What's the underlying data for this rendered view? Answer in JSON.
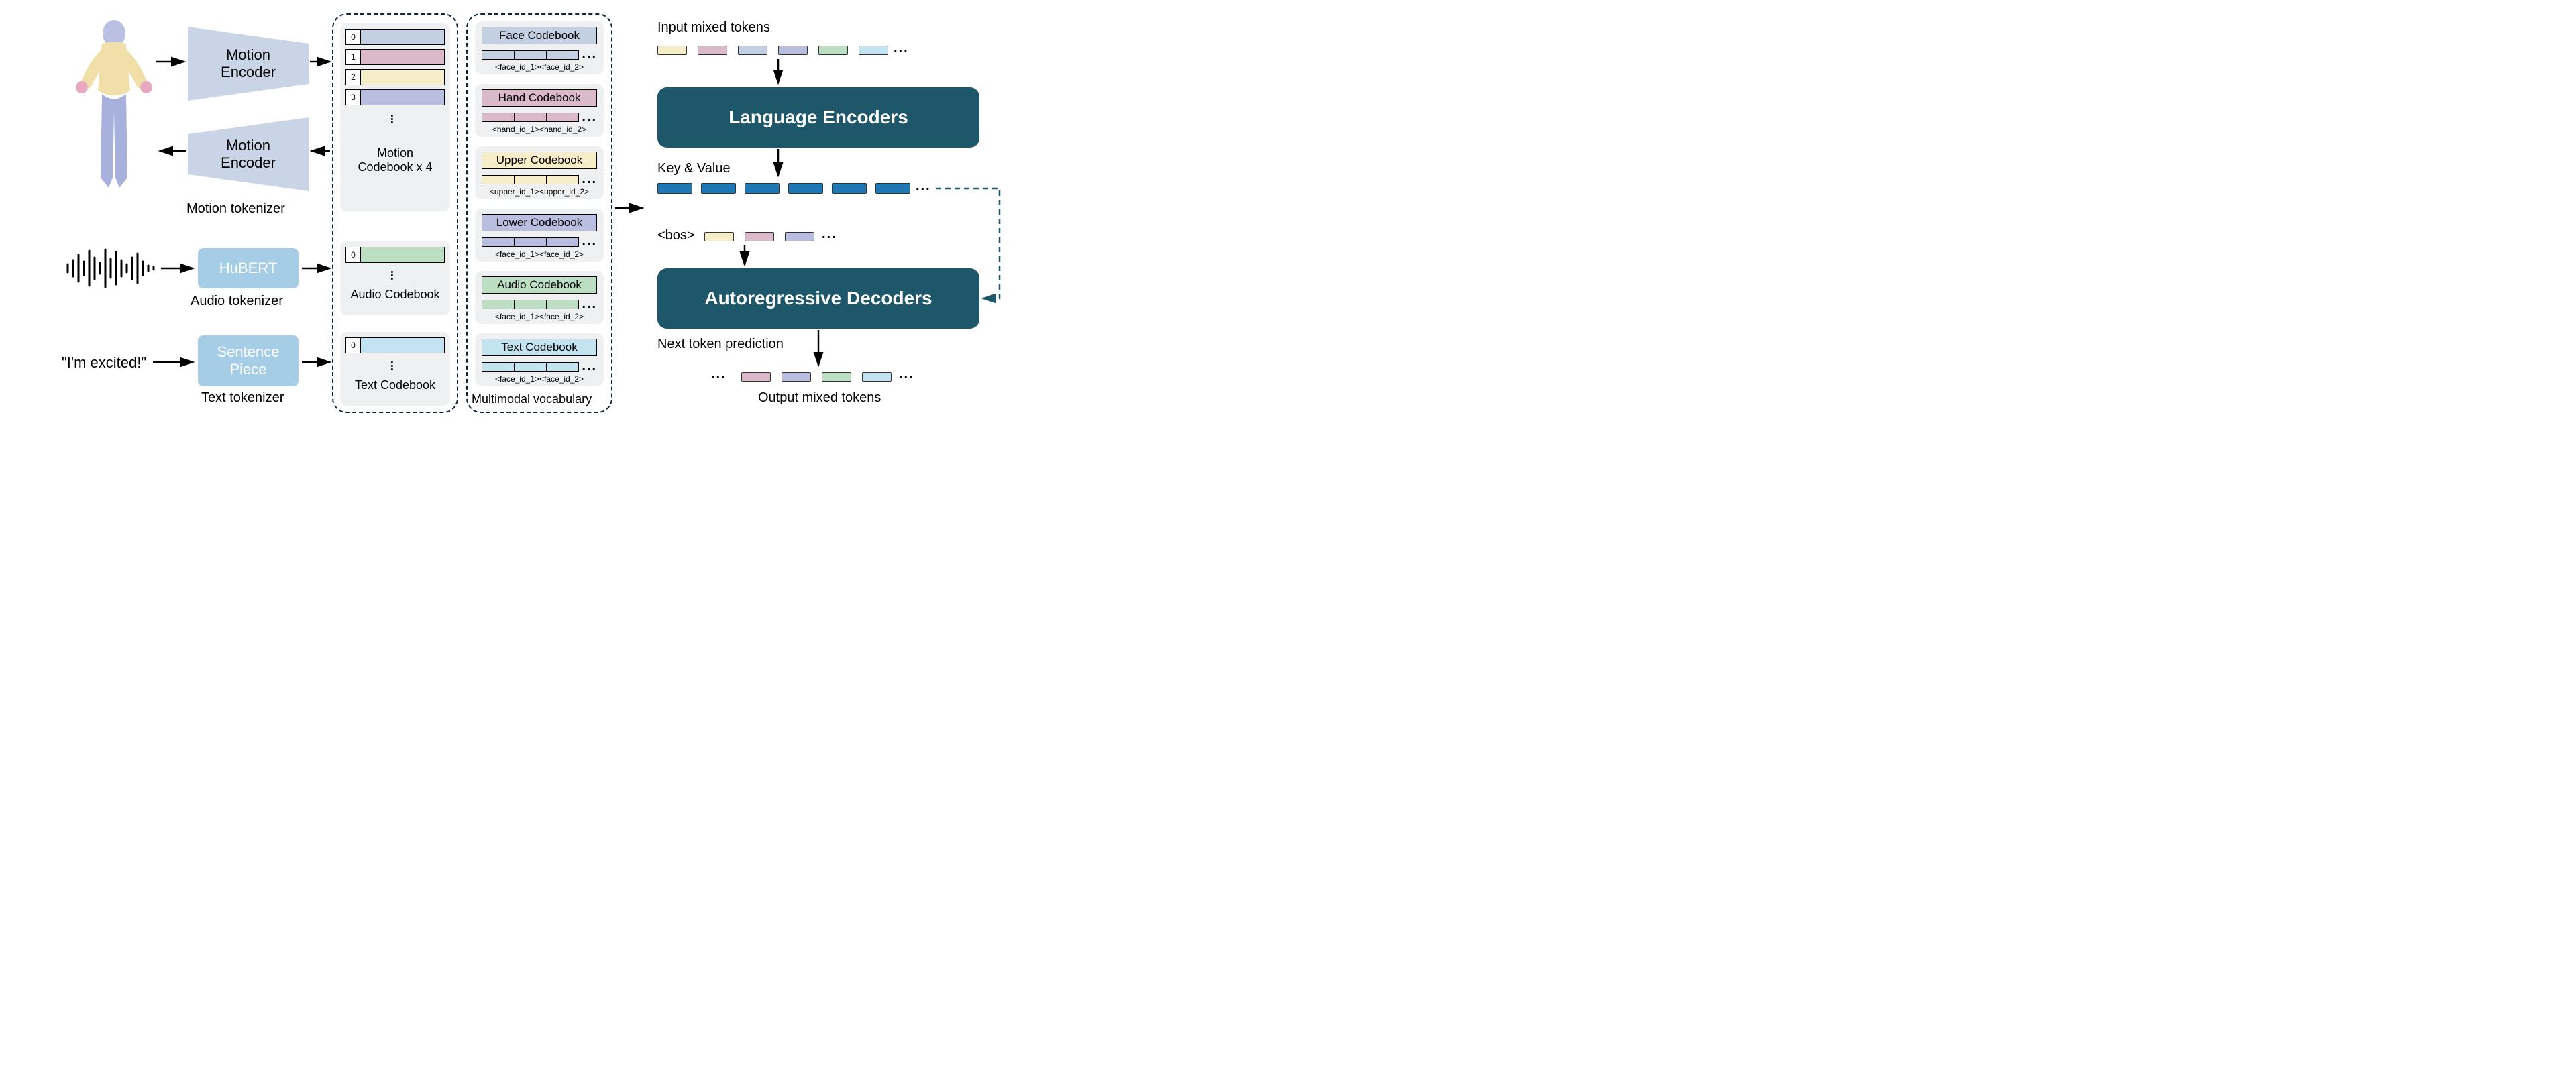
{
  "tokenizers": {
    "motion_encoder": "Motion\nEncoder",
    "motion_decoder": "Motion\nEncoder",
    "motion_label": "Motion tokenizer",
    "hubert": "HuBERT",
    "audio_label": "Audio tokenizer",
    "sentencepiece": "Sentence\nPiece",
    "text_label": "Text tokenizer",
    "text_input": "\"I'm excited!\""
  },
  "codebooks": {
    "motion_title": "Motion\nCodebook x 4",
    "audio_title": "Audio Codebook",
    "text_title": "Text Codebook",
    "idx": [
      "0",
      "1",
      "2",
      "3",
      "0",
      "0"
    ]
  },
  "vocab": {
    "title": "Multimodal vocabulary",
    "face": {
      "title": "Face Codebook",
      "ids": "<face_id_1><face_id_2>",
      "more": "..."
    },
    "hand": {
      "title": "Hand Codebook",
      "ids": "<hand_id_1><hand_id_2>",
      "more": "..."
    },
    "upper": {
      "title": "Upper Codebook",
      "ids": "<upper_id_1><upper_id_2>",
      "more": "..."
    },
    "lower": {
      "title": "Lower Codebook",
      "ids": "<face_id_1><face_id_2>",
      "more": "..."
    },
    "audio": {
      "title": "Audio Codebook",
      "ids": "<face_id_1><face_id_2>",
      "more": "..."
    },
    "text": {
      "title": "Text Codebook",
      "ids": "<face_id_1><face_id_2>",
      "more": "..."
    }
  },
  "model": {
    "input_label": "Input mixed tokens",
    "encoders": "Language Encoders",
    "kv_label": "Key & Value",
    "bos": "<bos>",
    "decoders": "Autoregressive Decoders",
    "next_label": "Next token prediction",
    "output_label": "Output mixed tokens",
    "more": "..."
  }
}
